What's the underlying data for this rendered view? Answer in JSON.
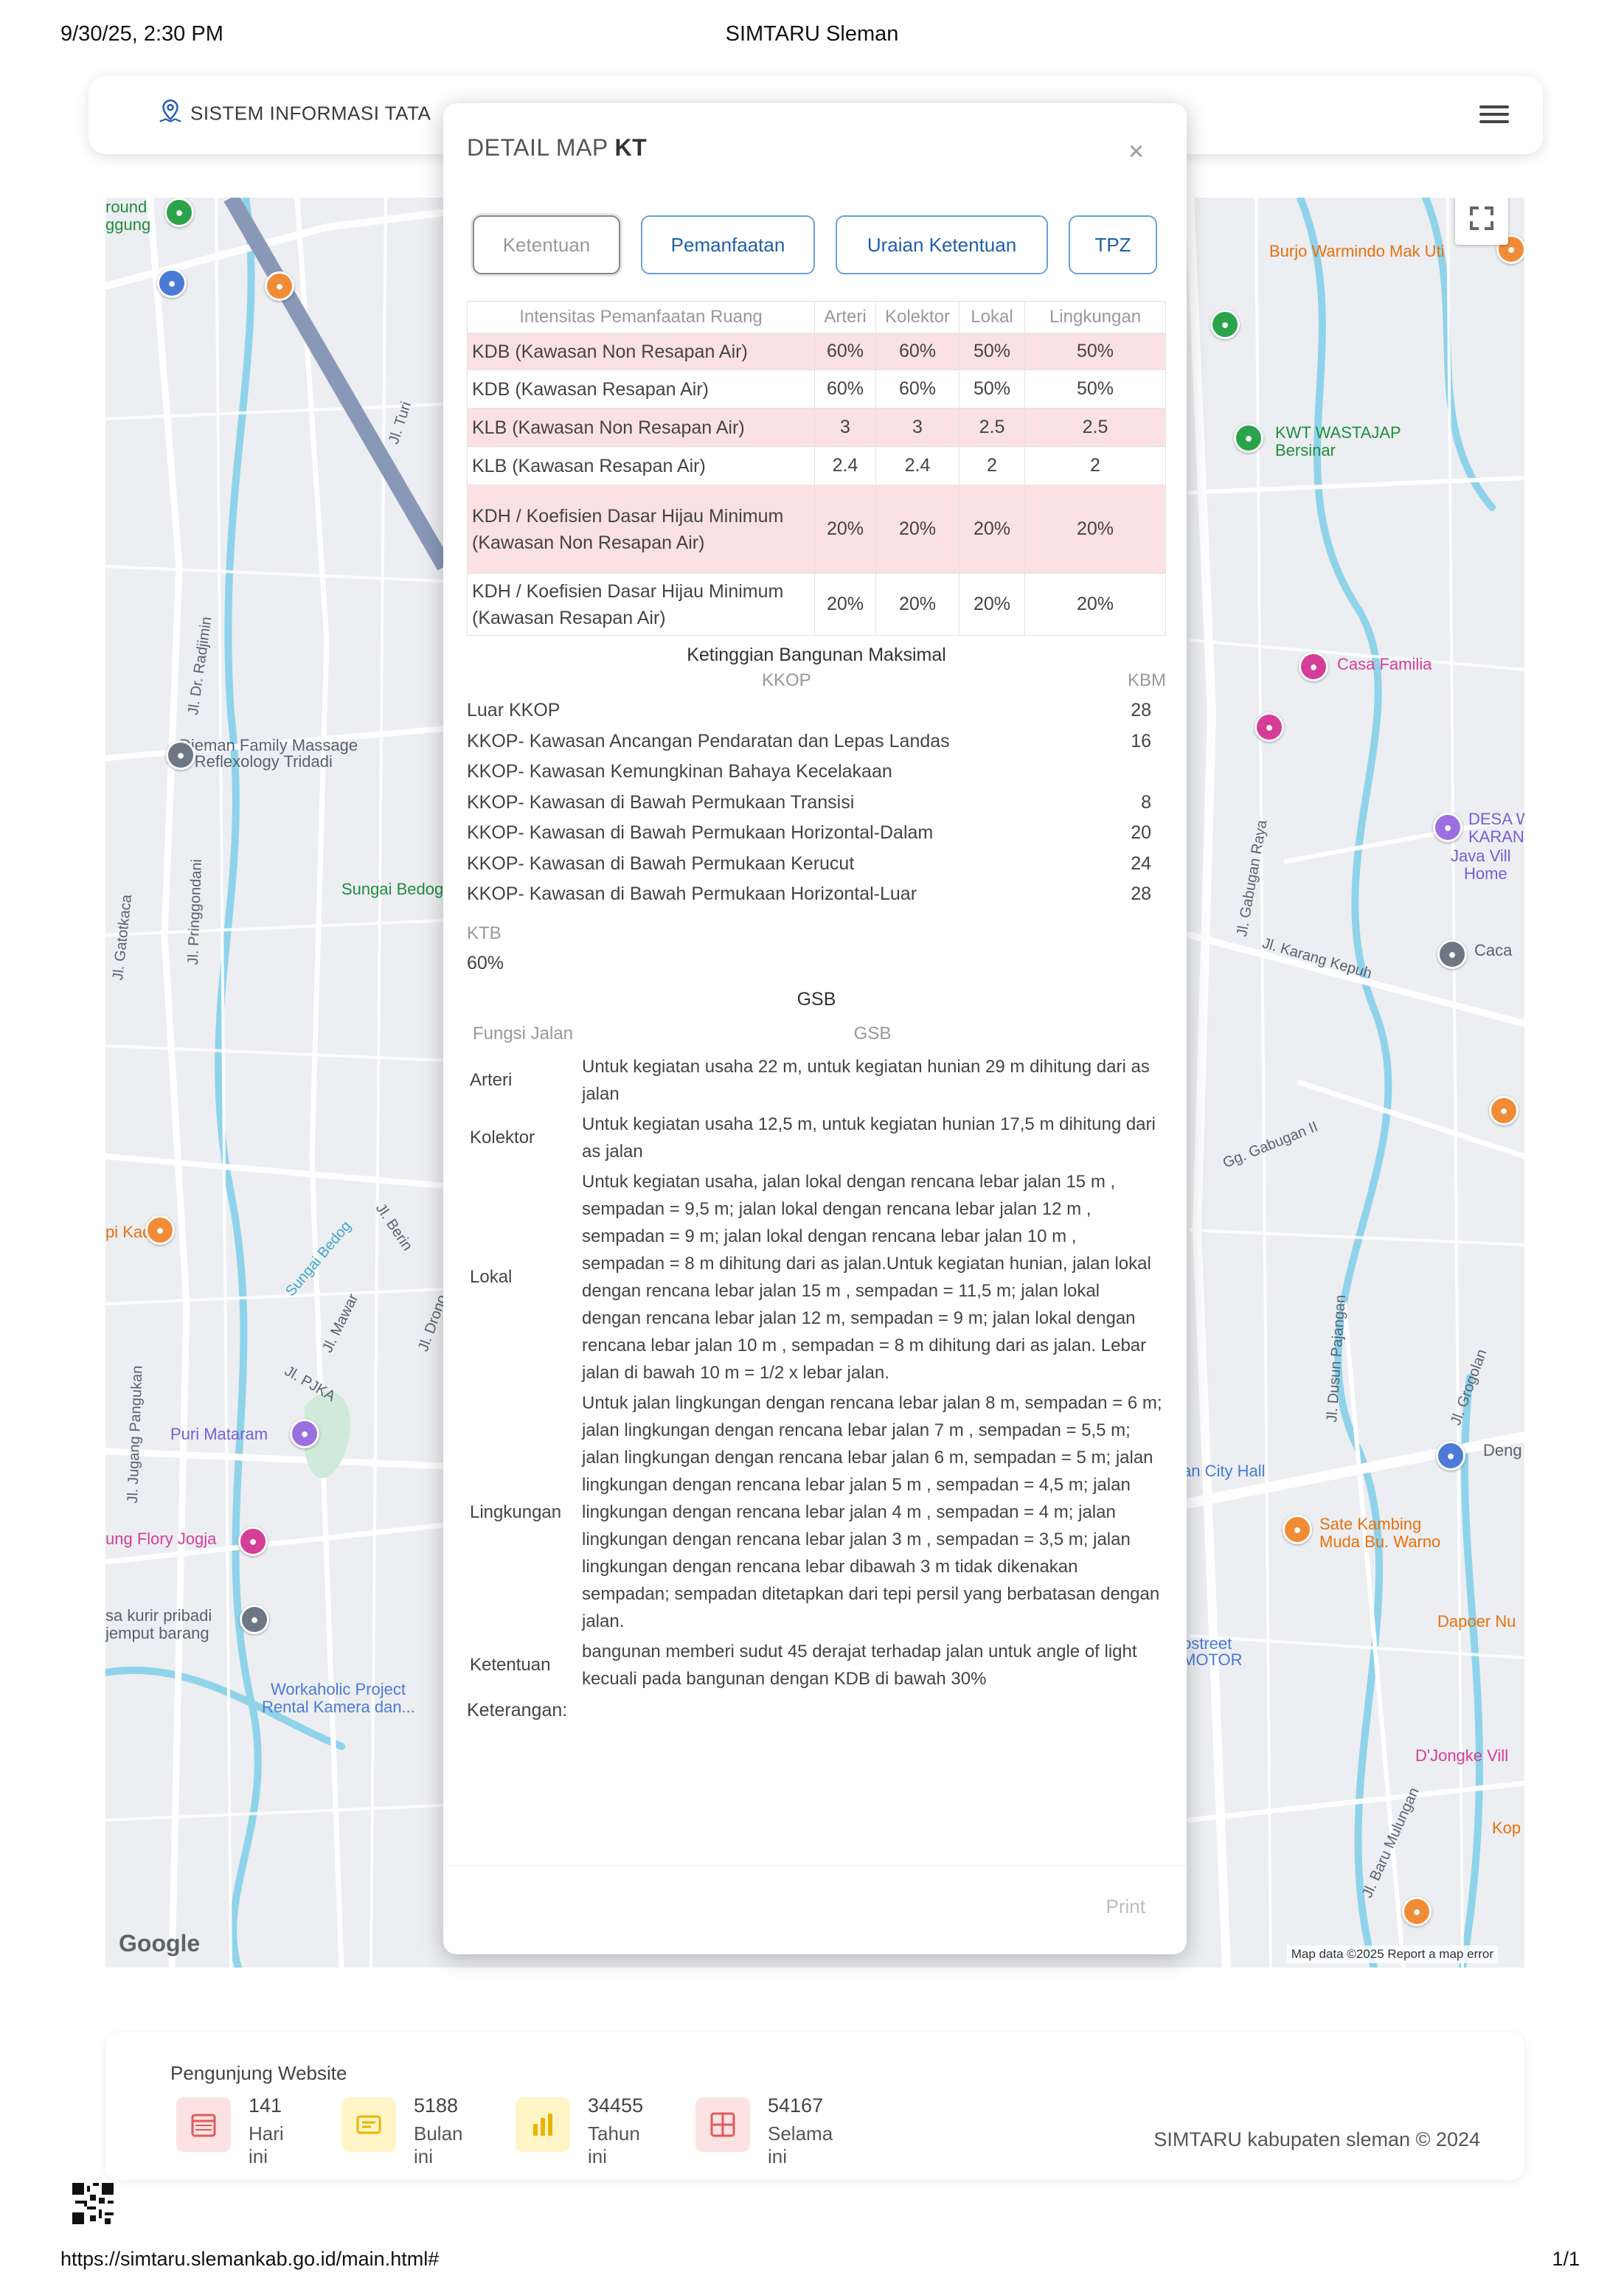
{
  "print_header": {
    "datetime": "9/30/25, 2:30 PM",
    "title": "SIMTARU Sleman"
  },
  "print_footer": {
    "url": "https://simtaru.slemankab.go.id/main.html#",
    "page": "1/1"
  },
  "navbar": {
    "brand": "SISTEM INFORMASI TATA"
  },
  "colors": {
    "accent": "#1f5fa8",
    "highlight_row": "#fbe1e1",
    "map_water": "#7fd0e8"
  },
  "map": {
    "labels": [
      {
        "text": "Djeman Family Massage",
        "cls": "lbl-gray"
      },
      {
        "text": "& Reflexology Tridadi",
        "cls": "lbl-gray"
      },
      {
        "text": "Sungai Bedog",
        "cls": "lbl-green"
      },
      {
        "text": "Puri Mataram",
        "cls": "lbl-purple"
      },
      {
        "text": "Workaholic Project",
        "cls": "lbl-blue"
      },
      {
        "text": "Rental Kamera dan...",
        "cls": "lbl-blue"
      },
      {
        "text": "Burjo Warmindo Mak Uti",
        "cls": "lbl-orange"
      },
      {
        "text": "KWT WASTAJAP",
        "cls": "lbl-green"
      },
      {
        "text": "Bersinar",
        "cls": "lbl-green"
      },
      {
        "text": "Casa Familia",
        "cls": "lbl-pink"
      },
      {
        "text": "Caca",
        "cls": "lbl-gray"
      },
      {
        "text": "DESA W",
        "cls": "lbl-purple"
      },
      {
        "text": "KARAN",
        "cls": "lbl-purple"
      },
      {
        "text": "Java Vill",
        "cls": "lbl-purple"
      },
      {
        "text": "Home",
        "cls": "lbl-purple"
      },
      {
        "text": "Sate Kambing",
        "cls": "lbl-orange"
      },
      {
        "text": "Muda Bu. Warno",
        "cls": "lbl-orange"
      },
      {
        "text": "D'Jongke Vill",
        "cls": "lbl-pink"
      },
      {
        "text": "Dapoer Nu",
        "cls": "lbl-orange"
      },
      {
        "text": "an City Hall",
        "cls": "lbl-blue"
      },
      {
        "text": "ung Flory Jogja",
        "cls": "lbl-pink"
      },
      {
        "text": "pi Kaclak",
        "cls": "lbl-orange"
      },
      {
        "text": "sa kurir pribadi",
        "cls": "lbl-gray"
      },
      {
        "text": "jemput barang",
        "cls": "lbl-gray"
      },
      {
        "text": "round",
        "cls": "lbl-green"
      },
      {
        "text": "ggung",
        "cls": "lbl-green"
      },
      {
        "text": "Kop",
        "cls": "lbl-orange"
      },
      {
        "text": "Deng",
        "cls": "lbl-gray"
      },
      {
        "text": "ostreet",
        "cls": "lbl-blue"
      },
      {
        "text": "MOTOR",
        "cls": "lbl-blue"
      }
    ],
    "roads": [
      "Jl. Turi",
      "Jl. Dr. Radjimin",
      "Jl. Gatotkaca",
      "Jl. Pringgondani",
      "Jl. Jugang Pangukan",
      "Jl. PJKA",
      "Jl. Gabugan Raya",
      "Jl. Karang Kepuh",
      "Gg. Gabugan II",
      "Jl. Dusun Pajangan",
      "Jl. Grogolan",
      "Jl. Baru Mulungan",
      "Sungai Bedog",
      "Jl. Mawar",
      "Jl. Berin",
      "Jl. Drono"
    ],
    "google": "Google",
    "attribution": "Map data ©2025  Report a map error"
  },
  "modal": {
    "title_prefix": "DETAIL MAP",
    "title_code": "KT",
    "close": "×",
    "tabs": [
      "Ketentuan",
      "Pemanfaatan",
      "Uraian Ketentuan",
      "TPZ"
    ],
    "intensity_table": {
      "headers": [
        "Intensitas Pemanfaatan Ruang",
        "Arteri",
        "Kolektor",
        "Lokal",
        "Lingkungan"
      ],
      "rows": [
        {
          "name": "KDB (Kawasan Non Resapan Air)",
          "vals": [
            "60%",
            "60%",
            "50%",
            "50%"
          ],
          "hl": true
        },
        {
          "name": "KDB (Kawasan Resapan Air)",
          "vals": [
            "60%",
            "60%",
            "50%",
            "50%"
          ],
          "hl": false
        },
        {
          "name": "KLB (Kawasan Non Resapan Air)",
          "vals": [
            "3",
            "3",
            "2.5",
            "2.5"
          ],
          "hl": true
        },
        {
          "name": "KLB (Kawasan Resapan Air)",
          "vals": [
            "2.4",
            "2.4",
            "2",
            "2"
          ],
          "hl": false
        },
        {
          "name": "KDH / Koefisien Dasar Hijau Minimum (Kawasan Non Resapan Air)",
          "vals": [
            "20%",
            "20%",
            "20%",
            "20%"
          ],
          "hl": true
        },
        {
          "name": "KDH / Koefisien Dasar Hijau Minimum (Kawasan Resapan Air)",
          "vals": [
            "20%",
            "20%",
            "20%",
            "20%"
          ],
          "hl": false
        }
      ]
    },
    "height_title": "Ketinggian Bangunan Maksimal",
    "kkop_header": {
      "a": "KKOP",
      "b": "KBM"
    },
    "kkop_rows": [
      {
        "n": "Luar KKOP",
        "v": "28"
      },
      {
        "n": "KKOP- Kawasan Ancangan Pendaratan dan Lepas Landas",
        "v": "16"
      },
      {
        "n": "KKOP- Kawasan Kemungkinan Bahaya Kecelakaan",
        "v": ""
      },
      {
        "n": "KKOP- Kawasan di Bawah Permukaan Transisi",
        "v": "8"
      },
      {
        "n": "KKOP- Kawasan di Bawah Permukaan Horizontal-Dalam",
        "v": "20"
      },
      {
        "n": "KKOP- Kawasan di Bawah Permukaan Kerucut",
        "v": "24"
      },
      {
        "n": "KKOP- Kawasan di Bawah Permukaan Horizontal-Luar",
        "v": "28"
      }
    ],
    "ktb_label": "KTB",
    "ktb_value": "60%",
    "gsb_title": "GSB",
    "gsb_headers": [
      "Fungsi Jalan",
      "GSB"
    ],
    "gsb_rows": [
      {
        "f": "Arteri",
        "t": "Untuk kegiatan usaha 22 m, untuk kegiatan hunian 29 m dihitung dari as jalan"
      },
      {
        "f": "Kolektor",
        "t": "Untuk kegiatan usaha 12,5 m, untuk kegiatan hunian 17,5 m dihitung dari as jalan"
      },
      {
        "f": "Lokal",
        "t": "Untuk kegiatan usaha, jalan lokal dengan rencana lebar jalan 15 m , sempadan = 9,5 m; jalan lokal dengan rencana lebar jalan 12 m , sempadan = 9 m; jalan lokal dengan rencana lebar jalan 10 m , sempadan = 8 m dihitung dari as jalan.Untuk kegiatan hunian, jalan lokal dengan rencana lebar jalan 15 m , sempadan = 11,5 m; jalan lokal dengan rencana lebar jalan 12 m, sempadan = 9 m; jalan lokal dengan rencana lebar jalan 10 m , sempadan = 8 m dihitung dari as jalan. Lebar jalan di bawah 10 m = 1/2 x lebar jalan."
      },
      {
        "f": "Lingkungan",
        "t": "Untuk jalan lingkungan dengan rencana lebar jalan 8 m, sempadan = 6 m; jalan lingkungan dengan rencana lebar jalan 7 m , sempadan = 5,5 m; jalan lingkungan dengan rencana lebar jalan 6 m, sempadan = 5 m; jalan lingkungan dengan rencana lebar jalan 5 m , sempadan = 4,5 m; jalan lingkungan dengan rencana lebar jalan 4 m , sempadan = 4 m; jalan lingkungan dengan rencana lebar jalan 3 m , sempadan = 3,5 m; jalan lingkungan dengan rencana lebar dibawah 3 m tidak dikenakan sempadan; sempadan ditetapkan dari tepi persil yang berbatasan dengan jalan."
      },
      {
        "f": "Ketentuan",
        "t": "bangunan memberi sudut 45 derajat terhadap jalan untuk angle of light kecuali pada bangunan dengan KDB di bawah 30%"
      }
    ],
    "keterangan": "Keterangan:",
    "print": "Print"
  },
  "visitors": {
    "title": "Pengunjung Website",
    "stats": [
      {
        "num": "141",
        "label": "Hari ini",
        "color": "#fde2e2",
        "icon": "calendar-icon"
      },
      {
        "num": "5188",
        "label": "Bulan ini",
        "color": "#fff5c7",
        "icon": "calendar-range-icon"
      },
      {
        "num": "34455",
        "label": "Tahun ini",
        "color": "#fff5c7",
        "icon": "bar-chart-icon"
      },
      {
        "num": "54167",
        "label": "Selama ini",
        "color": "#fde2e2",
        "icon": "grid-icon"
      }
    ],
    "copyright": "SIMTARU kabupaten sleman © 2024"
  }
}
